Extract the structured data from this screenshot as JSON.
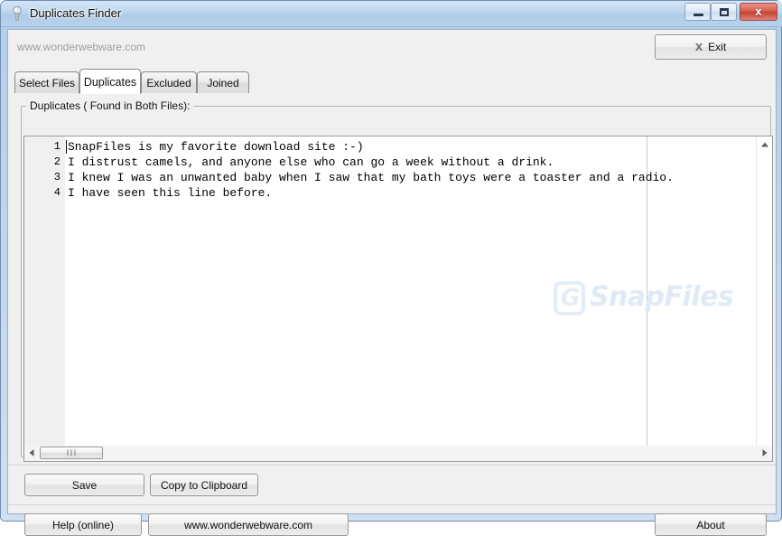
{
  "window": {
    "title": "Duplicates Finder",
    "icon": "app-pin-icon",
    "controls": {
      "minimize": "minimize-icon",
      "maximize": "maximize-icon",
      "close": "x"
    }
  },
  "header": {
    "url_label": "www.wonderwebware.com",
    "exit_button": "Exit",
    "exit_icon": "x"
  },
  "tabs": [
    {
      "label": "Select Files",
      "active": false
    },
    {
      "label": "Duplicates",
      "active": true
    },
    {
      "label": "Excluded",
      "active": false
    },
    {
      "label": "Joined",
      "active": false
    }
  ],
  "groupbox": {
    "label": "Duplicates ( Found in Both Files):"
  },
  "editor": {
    "watermark": "SnapFiles",
    "watermark_badge": "G",
    "lines": [
      {
        "num": "1",
        "text": "SnapFiles is my favorite download site :-)"
      },
      {
        "num": "2",
        "text": "I distrust camels, and anyone else who can go a week without a drink."
      },
      {
        "num": "3",
        "text": "I knew I was an unwanted baby when I saw that my bath toys were a toaster and a radio."
      },
      {
        "num": "4",
        "text": "I have seen this line before."
      }
    ]
  },
  "buttons": {
    "save": "Save",
    "copy_to_clipboard": "Copy to Clipboard",
    "help_online": "Help (online)",
    "website": "www.wonderwebware.com",
    "about": "About"
  },
  "colors": {
    "titlebar": "#b7d2ea",
    "close_button": "#c44134",
    "dialog_face": "#f0f0f0",
    "watermark": "#dfeaf6",
    "gutter": "#f0f0f0"
  }
}
